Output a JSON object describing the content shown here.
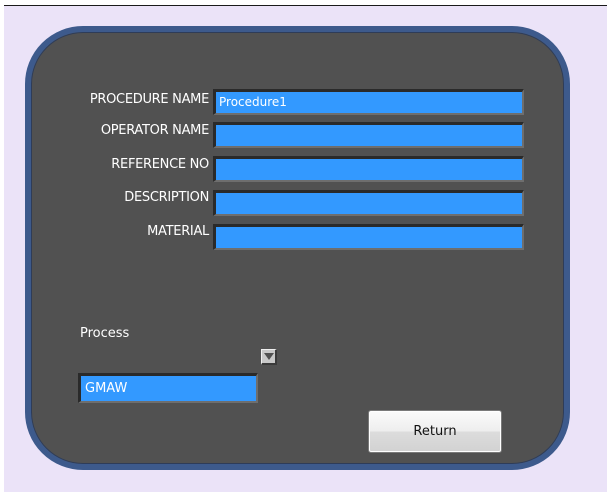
{
  "form": {
    "fields": [
      {
        "label": "PROCEDURE NAME",
        "value": "Procedure1"
      },
      {
        "label": "OPERATOR NAME",
        "value": ""
      },
      {
        "label": "REFERENCE NO",
        "value": ""
      },
      {
        "label": "DESCRIPTION",
        "value": ""
      },
      {
        "label": "MATERIAL",
        "value": ""
      }
    ]
  },
  "process": {
    "label": "Process",
    "selected": "GMAW",
    "dropdown_icon": "triangle-down-icon"
  },
  "actions": {
    "return_label": "Return"
  },
  "colors": {
    "panel_background": "#515151",
    "panel_border": "#3d5a8c",
    "field_background": "#3399ff",
    "window_background": "#ebe3f8",
    "label_text": "#ffffff"
  }
}
